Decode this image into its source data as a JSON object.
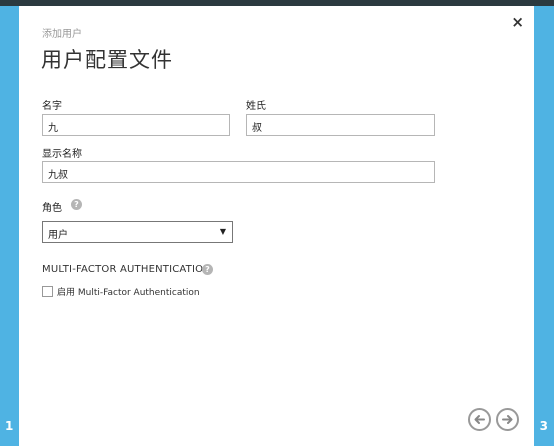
{
  "wizard": {
    "step_left": "1",
    "step_right": "3",
    "close_glyph": "×",
    "subtitle": "添加用户",
    "title": "用户配置文件"
  },
  "form": {
    "first_name_label": "名字",
    "first_name_value": "九",
    "last_name_label": "姓氏",
    "last_name_value": "叔",
    "display_name_label": "显示名称",
    "display_name_value": "九叔",
    "role_label": "角色",
    "role_selected": "用户",
    "help_glyph": "?",
    "select_arrow": "▼"
  },
  "mfa": {
    "section_title": "MULTI-FACTOR AUTHENTICATION",
    "enable_prefix": "启用",
    "enable_text": "Multi-Factor Authentication",
    "enabled": false
  },
  "colors": {
    "accent": "#4fb3e3",
    "topbar": "#2b3a40"
  },
  "icons": {
    "back": "back-arrow-icon",
    "next": "next-arrow-icon",
    "help": "help-icon",
    "close": "close-icon"
  }
}
